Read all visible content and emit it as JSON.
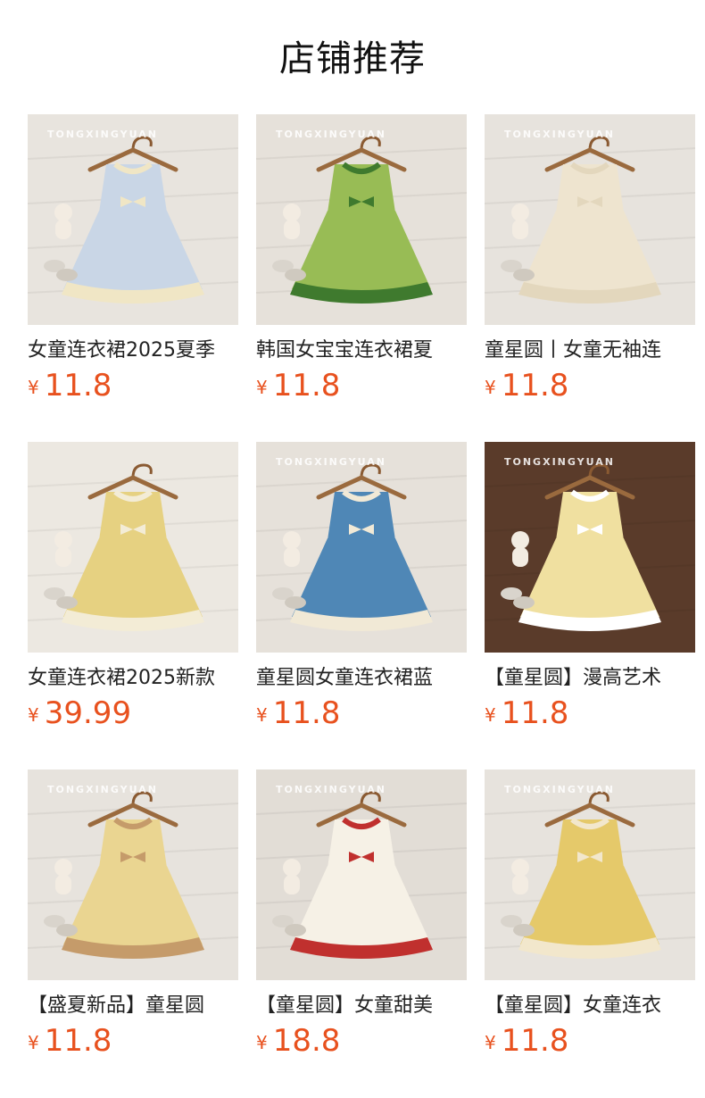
{
  "section": {
    "title": "店铺推荐"
  },
  "products": [
    {
      "name": "女童连衣裙2025夏季",
      "currency": "¥",
      "price": "11.8",
      "watermark": "TONGXINGYUAN",
      "dress_color": "#c9d6e6",
      "accent": "#f0e6c5",
      "bg": "#e8e4de",
      "icon": "gingham-dress-icon"
    },
    {
      "name": "韩国女宝宝连衣裙夏",
      "currency": "¥",
      "price": "11.8",
      "watermark": "TONGXINGYUAN",
      "dress_color": "#98bc55",
      "accent": "#3f7a2e",
      "bg": "#e6e1da",
      "icon": "watermelon-dress-icon"
    },
    {
      "name": "童星圆丨女童无袖连",
      "currency": "¥",
      "price": "11.8",
      "watermark": "TONGXINGYUAN",
      "dress_color": "#eee4cf",
      "accent": "#e3d7bd",
      "bg": "#e7e3dd",
      "icon": "lace-dress-icon"
    },
    {
      "name": "女童连衣裙2025新款",
      "currency": "¥",
      "price": "39.99",
      "watermark": "",
      "dress_color": "#e6d181",
      "accent": "#f3ecd6",
      "bg": "#ece8e1",
      "icon": "yellow-bow-dress-icon"
    },
    {
      "name": "童星圆女童连衣裙蓝",
      "currency": "¥",
      "price": "11.8",
      "watermark": "TONGXINGYUAN",
      "dress_color": "#4f87b6",
      "accent": "#f1e9d6",
      "bg": "#e6e1da",
      "icon": "blue-plaid-dress-icon"
    },
    {
      "name": "【童星圆】漫高艺术",
      "currency": "¥",
      "price": "11.8",
      "watermark": "TONGXINGYUAN",
      "dress_color": "#f0e0a0",
      "accent": "#ffffff",
      "bg": "#5a3b2a",
      "icon": "striped-sailor-dress-icon"
    },
    {
      "name": "【盛夏新品】童星圆",
      "currency": "¥",
      "price": "11.8",
      "watermark": "TONGXINGYUAN",
      "dress_color": "#ead591",
      "accent": "#c59b6a",
      "bg": "#e7e3dd",
      "icon": "bubble-dress-icon"
    },
    {
      "name": "【童星圆】女童甜美",
      "currency": "¥",
      "price": "18.8",
      "watermark": "TONGXINGYUAN",
      "dress_color": "#f6f1e6",
      "accent": "#c0302e",
      "bg": "#e2ddd6",
      "icon": "cherry-dress-icon"
    },
    {
      "name": "【童星圆】女童连衣",
      "currency": "¥",
      "price": "11.8",
      "watermark": "TONGXINGYUAN",
      "dress_color": "#e5c96a",
      "accent": "#f2e7cc",
      "bg": "#e7e3dd",
      "icon": "ruffle-bow-dress-icon"
    }
  ]
}
